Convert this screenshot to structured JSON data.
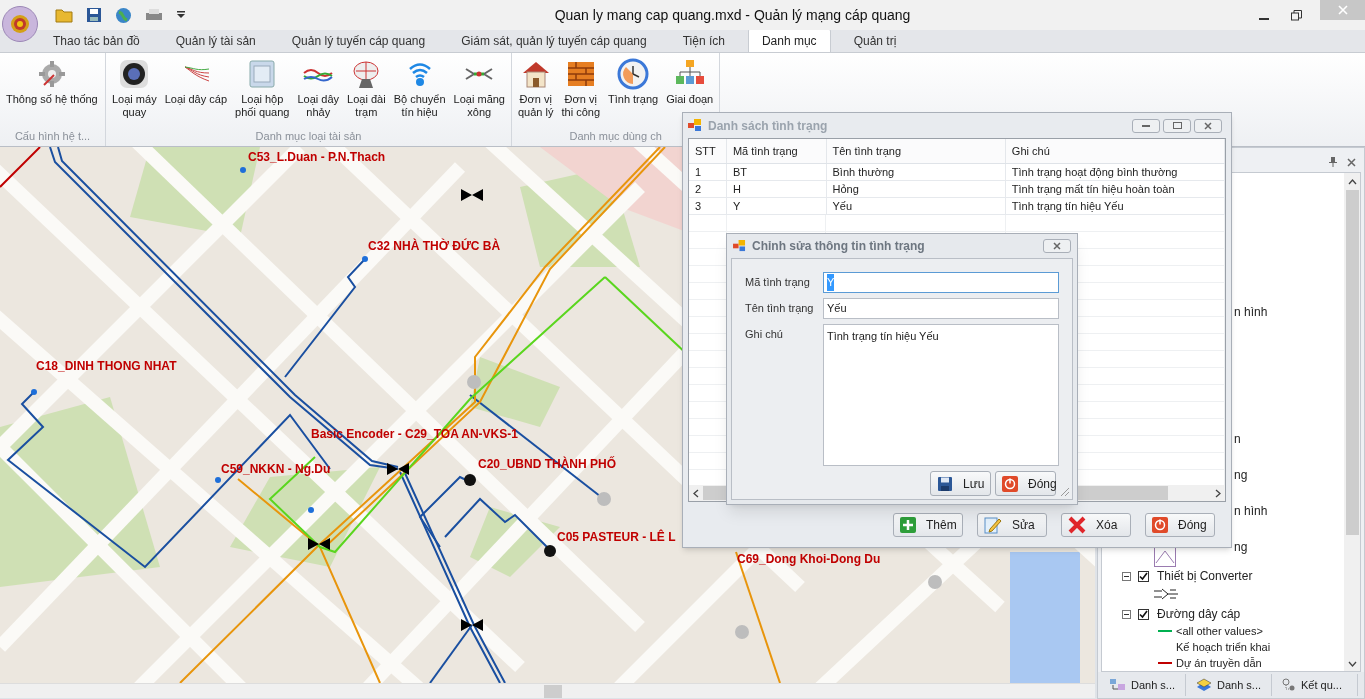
{
  "window": {
    "title": "Quan ly mang cap quang.mxd - Quản lý mạng cáp quang"
  },
  "ribbon_tabs": [
    {
      "label": "Thao tác bản đồ",
      "selected": false
    },
    {
      "label": "Quản lý tài sản",
      "selected": false
    },
    {
      "label": "Quản lý tuyến cáp quang",
      "selected": false
    },
    {
      "label": "Giám sát, quản lý tuyến cáp quang",
      "selected": false
    },
    {
      "label": "Tiện ích",
      "selected": false
    },
    {
      "label": "Danh mục",
      "selected": true
    },
    {
      "label": "Quản trị",
      "selected": false
    }
  ],
  "ribbon_groups": [
    {
      "label": "Cấu hình hệ t...",
      "items": [
        "Thông số hệ thống"
      ]
    },
    {
      "label": "Danh mục loại tài sản",
      "items": [
        "Loại máy\nquay",
        "Loại dây cáp",
        "Loại hộp\nphối quang",
        "Loại dây\nnhảy",
        "Loại đài\ntrạm",
        "Bộ chuyển\ntín hiệu",
        "Loại măng\nxông"
      ]
    },
    {
      "label": "Danh mục dùng ch",
      "items": [
        "Đơn vị\nquản lý",
        "Đơn vị\nthi công",
        "Tình trạng",
        "Giai đoạn"
      ]
    }
  ],
  "map": {
    "labels": [
      "C53_L.Duan - P.N.Thach",
      "C32 NHÀ THỜ ĐỨC BÀ",
      "C18_DINH THONG NHAT",
      "Basic Encoder - C29_TOA AN-VKS-1",
      "C59_NKKN - Ng.Du",
      "C20_UBND THÀNH PHỐ",
      "C05 PASTEUR - LÊ L",
      "C69_Dong Khoi-Dong Du"
    ]
  },
  "list_dialog": {
    "title": "Danh sách tình trạng",
    "columns": [
      "STT",
      "Mã tình trạng",
      "Tên tình trạng",
      "Ghi chú"
    ],
    "rows": [
      [
        "1",
        "BT",
        "Bình thường",
        "Tình trạng hoạt động bình thường"
      ],
      [
        "2",
        "H",
        "Hỏng",
        "Tình trạng mất tín hiệu hoàn toàn"
      ],
      [
        "3",
        "Y",
        "Yếu",
        "Tình trạng tín hiệu Yếu"
      ]
    ],
    "buttons": [
      {
        "kind": "add",
        "label": "Thêm"
      },
      {
        "kind": "edit",
        "label": "Sửa"
      },
      {
        "kind": "delete",
        "label": "Xóa"
      },
      {
        "kind": "close",
        "label": "Đóng"
      }
    ]
  },
  "edit_dialog": {
    "title": "Chỉnh sửa thông tin tình trạng",
    "fields": [
      {
        "kind": "text",
        "label": "Mã tình trạng",
        "value": "Y",
        "text_selected": true
      },
      {
        "kind": "text",
        "label": "Tên tình trạng",
        "value": "Yếu",
        "text_selected": false
      },
      {
        "kind": "memo",
        "label": "Ghi chú",
        "value": "Tình trạng tín hiệu Yếu",
        "text_selected": false
      }
    ],
    "buttons": [
      {
        "kind": "save",
        "label": "Lưu"
      },
      {
        "kind": "close",
        "label": "Đóng"
      }
    ]
  },
  "legend": {
    "fragments": [
      "n hình",
      "n",
      "ng",
      "n hình",
      "ng"
    ],
    "items": [
      {
        "kind": "symbol"
      },
      {
        "kind": "layer",
        "label": "Thiết bị Converter",
        "checked": true,
        "expanded": true
      },
      {
        "kind": "symbol"
      },
      {
        "kind": "layer",
        "label": "Đường dây cáp",
        "checked": true,
        "expanded": true
      },
      {
        "kind": "class",
        "label": "<all other values>",
        "color": "#00b050"
      },
      {
        "kind": "class",
        "label": "Kế hoạch triển khai"
      },
      {
        "kind": "class",
        "label": "Dự án truyền dẫn",
        "color": "#c00000"
      }
    ]
  },
  "panel_tabs": [
    "Danh s...",
    "Danh s...",
    "Kết qu..."
  ]
}
